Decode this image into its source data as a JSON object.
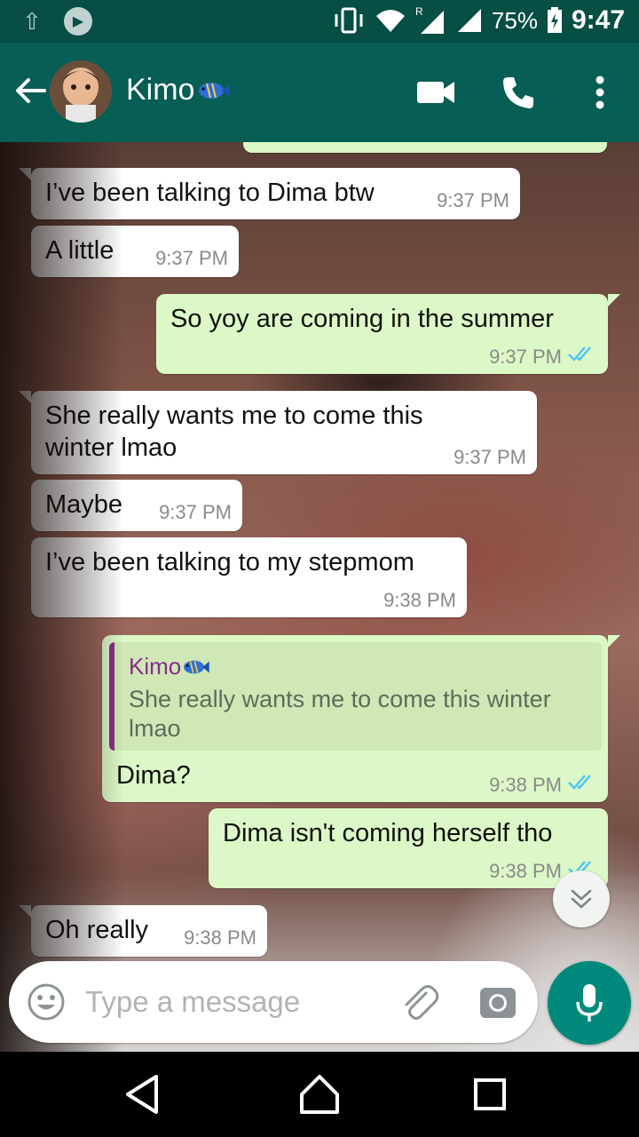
{
  "status_bar": {
    "battery": "75%",
    "time": "9:47",
    "roaming": "R"
  },
  "header": {
    "contact_name": "Kimo",
    "contact_emoji": "tropical-fish-icon"
  },
  "messages": [
    {
      "dir": "in",
      "text": "I’ve been talking to Dima btw",
      "time": "9:37 PM"
    },
    {
      "dir": "in",
      "text": "A little",
      "time": "9:37 PM"
    },
    {
      "dir": "out",
      "text": "So yoy are coming in the summer",
      "time": "9:37 PM"
    },
    {
      "dir": "in",
      "text_line1": "She really wants me to come this",
      "text_line2": "winter lmao",
      "time": "9:37 PM"
    },
    {
      "dir": "in",
      "text": "Maybe",
      "time": "9:37 PM"
    },
    {
      "dir": "in",
      "text": "I’ve been talking to my stepmom",
      "time": "9:38 PM"
    },
    {
      "dir": "out",
      "quote_name": "Kimo",
      "quote_text": "She really wants me to come this winter lmao",
      "text": "Dima?",
      "time": "9:38 PM"
    },
    {
      "dir": "out",
      "text": "Dima isn't coming herself tho",
      "time": "9:38 PM"
    },
    {
      "dir": "in",
      "text": "Oh really",
      "time": "9:38 PM"
    }
  ],
  "composer": {
    "placeholder": "Type a message"
  },
  "colors": {
    "header": "#075e54",
    "status_bar": "#074e45",
    "outgoing_bubble": "#dcf8c6",
    "incoming_bubble": "#ffffff",
    "mic_button": "#00897b",
    "read_ticks": "#4fc3f7",
    "quote_accent": "#8b2c8a"
  }
}
